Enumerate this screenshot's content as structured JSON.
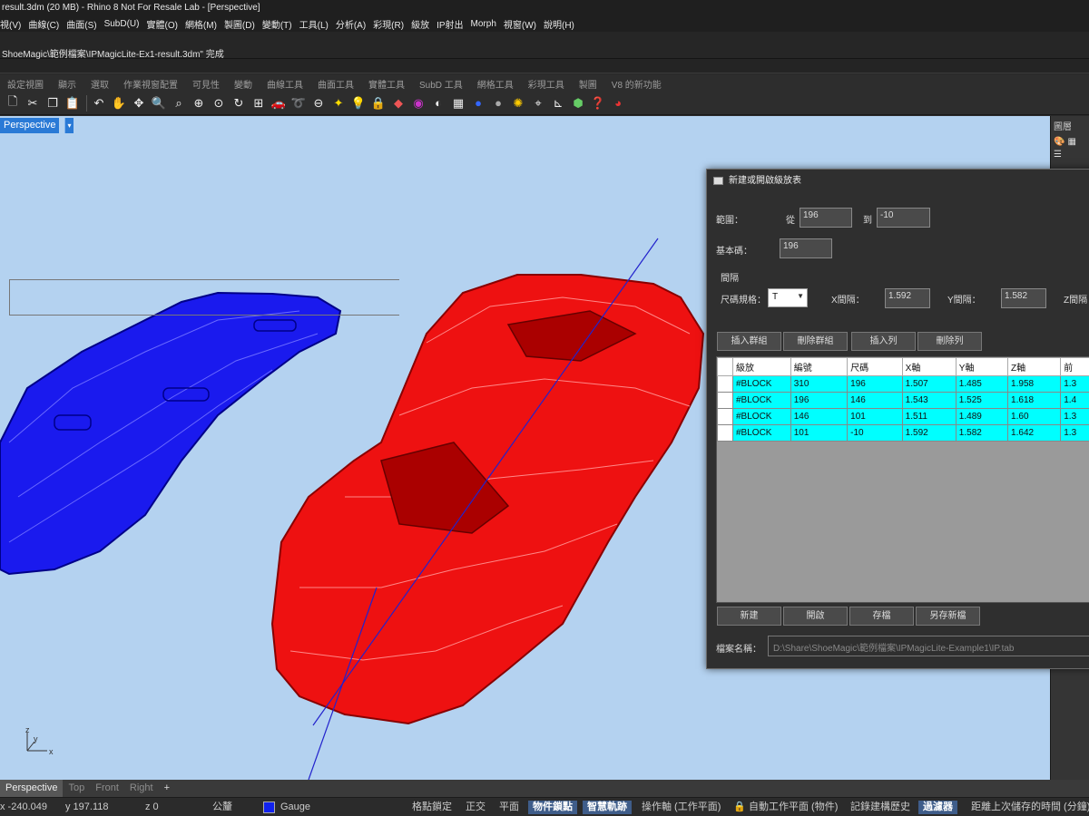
{
  "title_bar": {
    "text": "result.3dm (20 MB) - Rhino 8 Not For Resale Lab - [Perspective]"
  },
  "menu": [
    "視(V)",
    "曲線(C)",
    "曲面(S)",
    "SubD(U)",
    "實體(O)",
    "網格(M)",
    "製圖(D)",
    "變動(T)",
    "工具(L)",
    "分析(A)",
    "彩現(R)",
    "級放",
    "IP射出",
    "Morph",
    "視窗(W)",
    "說明(H)"
  ],
  "command_history": "ShoeMagic\\範例檔案\\IPMagicLite-Ex1-result.3dm\" 完成",
  "toolbar_tabs": [
    "設定視圖",
    "顯示",
    "選取",
    "作業視窗配置",
    "可見性",
    "變動",
    "曲線工具",
    "曲面工具",
    "實體工具",
    "SubD 工具",
    "網格工具",
    "彩現工具",
    "製圖",
    "V8 的新功能"
  ],
  "toolbar_icons": [
    "new-icon",
    "cut-icon",
    "copy-icon",
    "paste-icon",
    "undo-icon",
    "pan-hand-icon",
    "rotate-view-icon",
    "zoom-icon",
    "zoom-window-icon",
    "zoom-extents-icon",
    "zoom-selected-icon",
    "rotate-icon",
    "four-viewports-icon",
    "car-icon",
    "lasso-icon",
    "properties-icon",
    "point-light-icon",
    "lock-icon",
    "paint-bucket-icon",
    "color-wheel-icon",
    "render-sphere-icon",
    "mesh-grid-icon",
    "material-sphere-icon",
    "blue-sphere-icon",
    "gear-sun-icon",
    "named-position-icon",
    "dimension-icon",
    "cube-icon",
    "help-icon",
    "rhino-logo-icon"
  ],
  "viewport": {
    "label": "Perspective",
    "dropdown_glyph": "▾",
    "axis_labels": {
      "z": "z",
      "y": "y",
      "x": "x"
    }
  },
  "right_panel": {
    "title": "圖層"
  },
  "viewport_tabs": [
    "Perspective",
    "Top",
    "Front",
    "Right",
    "+"
  ],
  "status_bar": {
    "x": "x -240.049",
    "y": "y 197.118",
    "z": "z 0",
    "units": "公釐",
    "layer_color": "#1122ee",
    "layer": "Gauge",
    "grid_snap": "格點鎖定",
    "ortho": "正交",
    "planar": "平面",
    "osnap": "物件鎖點",
    "smart_track": "智慧軌跡",
    "gumball": "操作軸 (工作平面)",
    "lock_icon": "lock-icon",
    "auto_cplane": "自動工作平面 (物件)",
    "record_history": "記錄建構歷史",
    "filter": "過濾器",
    "save_time": "距離上次儲存的時間 (分鐘)"
  },
  "dialog": {
    "title": "新建或開啟級放表",
    "range_label": "範圍：",
    "from_label": "從",
    "from_value": "196",
    "to_label": "到",
    "to_value": "-10",
    "base_label": "基本碼：",
    "base_value": "196",
    "interval_group": "間隔",
    "size_spec_label": "尺碼規格：",
    "size_spec_value": "T",
    "x_interval_label": "X間隔：",
    "x_interval_value": "1.592",
    "y_interval_label": "Y間隔：",
    "y_interval_value": "1.582",
    "z_interval_label": "Z間隔",
    "buttons_top": [
      "插入群組",
      "刪除群組",
      "插入列",
      "刪除列"
    ],
    "table": {
      "columns": [
        "級放",
        "編號",
        "尺碼",
        "X軸",
        "Y軸",
        "Z軸",
        "前"
      ],
      "rows": [
        [
          "#BLOCK",
          "310",
          "196",
          "1.507",
          "1.485",
          "1.958",
          "1.3"
        ],
        [
          "#BLOCK",
          "196",
          "146",
          "1.543",
          "1.525",
          "1.618",
          "1.4"
        ],
        [
          "#BLOCK",
          "146",
          "101",
          "1.511",
          "1.489",
          "1.60",
          "1.3"
        ],
        [
          "#BLOCK",
          "101",
          "-10",
          "1.592",
          "1.582",
          "1.642",
          "1.3"
        ]
      ]
    },
    "buttons_bottom": [
      "新建",
      "開啟",
      "存檔",
      "另存新檔"
    ],
    "filename_label": "檔案名稱：",
    "filename_value": "D:\\Share\\ShoeMagic\\範例檔案\\IPMagicLite-Example1\\IP.tab"
  }
}
